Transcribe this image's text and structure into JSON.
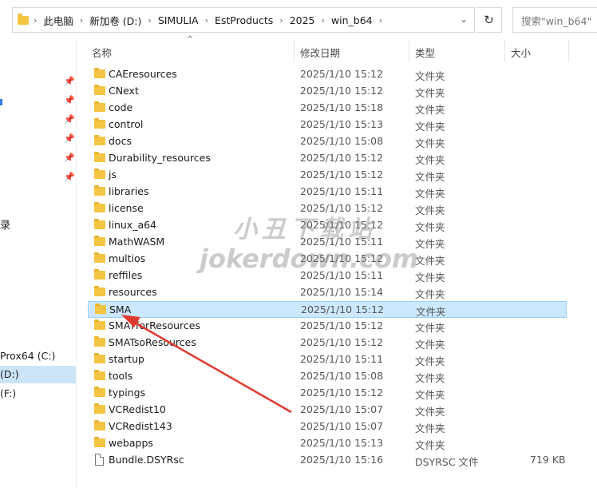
{
  "address": {
    "crumbs": [
      "此电脑",
      "新加卷 (D:)",
      "SIMULIA",
      "EstProducts",
      "2025",
      "win_b64"
    ],
    "search_placeholder": "搜索\"win_b64\""
  },
  "sidebar": {
    "partial_char": "录",
    "drives": [
      "Prox64 (C:)",
      "(D:)",
      "(F:)"
    ]
  },
  "columns": {
    "name": "名称",
    "date": "修改日期",
    "type": "类型",
    "size": "大小"
  },
  "files": [
    {
      "name": "CAEresources",
      "date": "2025/1/10 15:12",
      "type": "文件夹",
      "size": ""
    },
    {
      "name": "CNext",
      "date": "2025/1/10 15:12",
      "type": "文件夹",
      "size": ""
    },
    {
      "name": "code",
      "date": "2025/1/10 15:18",
      "type": "文件夹",
      "size": ""
    },
    {
      "name": "control",
      "date": "2025/1/10 15:13",
      "type": "文件夹",
      "size": ""
    },
    {
      "name": "docs",
      "date": "2025/1/10 15:08",
      "type": "文件夹",
      "size": ""
    },
    {
      "name": "Durability_resources",
      "date": "2025/1/10 15:12",
      "type": "文件夹",
      "size": ""
    },
    {
      "name": "js",
      "date": "2025/1/10 15:12",
      "type": "文件夹",
      "size": ""
    },
    {
      "name": "libraries",
      "date": "2025/1/10 15:11",
      "type": "文件夹",
      "size": ""
    },
    {
      "name": "license",
      "date": "2025/1/10 15:12",
      "type": "文件夹",
      "size": ""
    },
    {
      "name": "linux_a64",
      "date": "2025/1/10 15:12",
      "type": "文件夹",
      "size": ""
    },
    {
      "name": "MathWASM",
      "date": "2025/1/10 15:11",
      "type": "文件夹",
      "size": ""
    },
    {
      "name": "multios",
      "date": "2025/1/10 15:12",
      "type": "文件夹",
      "size": ""
    },
    {
      "name": "reffiles",
      "date": "2025/1/10 15:11",
      "type": "文件夹",
      "size": ""
    },
    {
      "name": "resources",
      "date": "2025/1/10 15:14",
      "type": "文件夹",
      "size": ""
    },
    {
      "name": "SMA",
      "date": "2025/1/10 15:12",
      "type": "文件夹",
      "size": "",
      "selected": true
    },
    {
      "name": "SMATforResources",
      "date": "2025/1/10 15:12",
      "type": "文件夹",
      "size": ""
    },
    {
      "name": "SMATsoResources",
      "date": "2025/1/10 15:12",
      "type": "文件夹",
      "size": ""
    },
    {
      "name": "startup",
      "date": "2025/1/10 15:11",
      "type": "文件夹",
      "size": ""
    },
    {
      "name": "tools",
      "date": "2025/1/10 15:08",
      "type": "文件夹",
      "size": ""
    },
    {
      "name": "typings",
      "date": "2025/1/10 15:12",
      "type": "文件夹",
      "size": ""
    },
    {
      "name": "VCRedist10",
      "date": "2025/1/10 15:07",
      "type": "文件夹",
      "size": ""
    },
    {
      "name": "VCRedist143",
      "date": "2025/1/10 15:07",
      "type": "文件夹",
      "size": ""
    },
    {
      "name": "webapps",
      "date": "2025/1/10 15:13",
      "type": "文件夹",
      "size": ""
    },
    {
      "name": "Bundle.DSYRsc",
      "date": "2025/1/10 15:16",
      "type": "DSYRSC 文件",
      "size": "719 KB",
      "is_file": true
    }
  ],
  "watermark": {
    "line1": "小丑下载站",
    "line2": "jokerdown.com"
  },
  "colors": {
    "selection": "#cce8ff",
    "folder": "#f4c542",
    "arrow": "#e03a2f"
  }
}
